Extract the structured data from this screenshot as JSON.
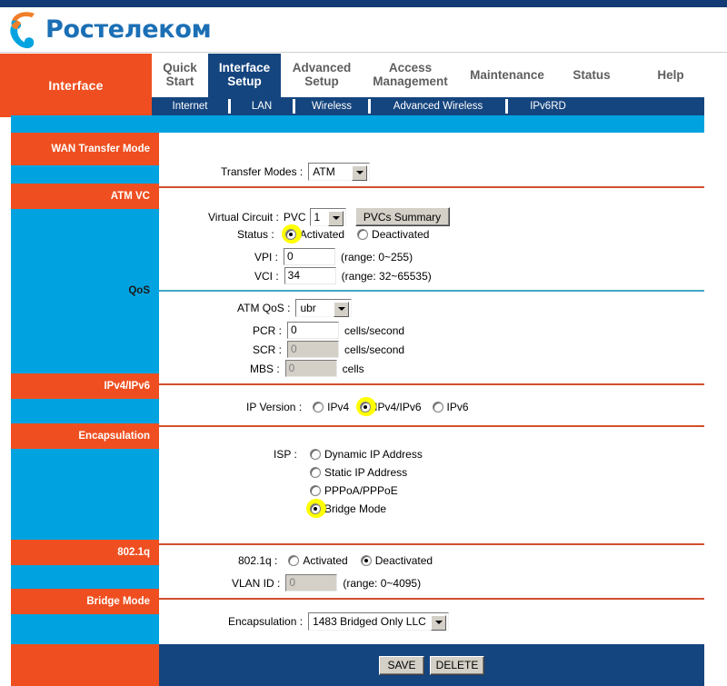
{
  "brand": {
    "name": "Ростелеком",
    "logo_icon": "rostelecom-ear-logo"
  },
  "header": {
    "section_label": "Interface",
    "tabs": [
      {
        "label": "Quick\nStart",
        "active": false
      },
      {
        "label": "Interface\nSetup",
        "active": true
      },
      {
        "label": "Advanced\nSetup",
        "active": false
      },
      {
        "label": "Access\nManagement",
        "active": false
      },
      {
        "label": "Maintenance",
        "active": false
      },
      {
        "label": "Status",
        "active": false
      },
      {
        "label": "Help",
        "active": false
      }
    ],
    "subtabs": [
      {
        "label": "Internet",
        "active": true
      },
      {
        "label": "LAN",
        "active": false
      },
      {
        "label": "Wireless",
        "active": false
      },
      {
        "label": "Advanced Wireless",
        "active": false
      },
      {
        "label": "IPv6RD",
        "active": false
      }
    ]
  },
  "sidebar": {
    "sections": [
      {
        "label": "WAN Transfer Mode",
        "style": "orange"
      },
      {
        "label": "ATM VC",
        "style": "orange"
      },
      {
        "label": "QoS",
        "style": "cyan"
      },
      {
        "label": "IPv4/IPv6",
        "style": "orange"
      },
      {
        "label": "Encapsulation",
        "style": "orange"
      },
      {
        "label": "802.1q",
        "style": "orange"
      },
      {
        "label": "Bridge Mode",
        "style": "orange"
      }
    ]
  },
  "form": {
    "transfer_modes": {
      "label": "Transfer Modes :",
      "value": "ATM"
    },
    "virtual_circuit": {
      "label": "Virtual Circuit :",
      "prefix": "PVC",
      "value": "1",
      "summary_button": "PVCs Summary"
    },
    "status": {
      "label": "Status :",
      "activated": "Activated",
      "deactivated": "Deactivated",
      "selected": "Activated"
    },
    "vpi": {
      "label": "VPI :",
      "value": "0",
      "hint": "(range: 0~255)"
    },
    "vci": {
      "label": "VCI :",
      "value": "34",
      "hint": "(range: 32~65535)"
    },
    "atm_qos": {
      "label": "ATM QoS :",
      "value": "ubr"
    },
    "pcr": {
      "label": "PCR :",
      "value": "0",
      "unit": "cells/second",
      "disabled": false
    },
    "scr": {
      "label": "SCR :",
      "value": "0",
      "unit": "cells/second",
      "disabled": true
    },
    "mbs": {
      "label": "MBS :",
      "value": "0",
      "unit": "cells",
      "disabled": true
    },
    "ip_version": {
      "label": "IP Version :",
      "options": [
        "IPv4",
        "IPv4/IPv6",
        "IPv6"
      ],
      "selected": "IPv4/IPv6"
    },
    "isp": {
      "label": "ISP :",
      "options": [
        "Dynamic IP Address",
        "Static IP Address",
        "PPPoA/PPPoE",
        "Bridge Mode"
      ],
      "selected": "Bridge Mode"
    },
    "dot1q": {
      "label": "802.1q :",
      "activated": "Activated",
      "deactivated": "Deactivated",
      "selected": "Deactivated"
    },
    "vlan_id": {
      "label": "VLAN ID :",
      "value": "0",
      "hint": "(range: 0~4095)",
      "disabled": true
    },
    "encapsulation": {
      "label": "Encapsulation :",
      "value": "1483 Bridged Only LLC"
    }
  },
  "footer": {
    "save": "SAVE",
    "delete": "DELETE"
  },
  "colors": {
    "orange": "#ef4f20",
    "cyan": "#00a3e0",
    "navy": "#15457e",
    "navy_dark": "#123a74",
    "logo_blue": "#1b6fb5",
    "divider_orange": "#d1502e",
    "divider_blue": "#3fa6c8",
    "highlight": "#ffff00"
  }
}
